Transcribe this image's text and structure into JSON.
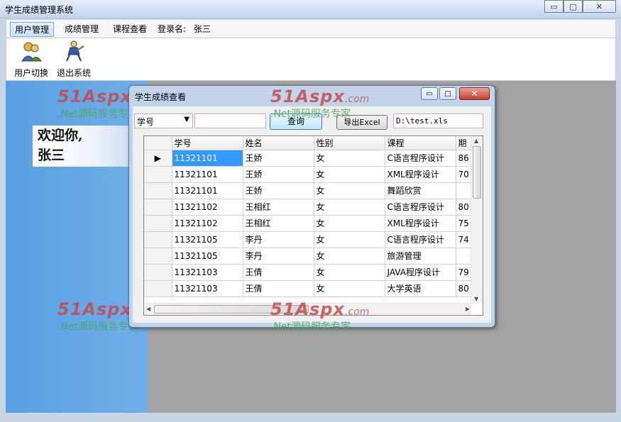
{
  "window": {
    "title": "学生成绩管理系统",
    "controls": {
      "minimize": "▭",
      "maximize": "□",
      "close": "✕"
    }
  },
  "menu": {
    "user_mgmt": "用户管理",
    "score_mgmt": "成绩管理",
    "course_view": "课程查看",
    "login_label": "登录名:",
    "login_name": "张三"
  },
  "toolbar": {
    "switch_user": "用户切换",
    "exit_system": "退出系统"
  },
  "welcome": {
    "line1": "欢迎你,",
    "line2": "张三"
  },
  "watermark": {
    "brand": "51Aspx",
    "domain": ".com",
    "tagline": ".Net源码服务专家"
  },
  "dialog": {
    "title": "学生成绩查看",
    "field_select": "学号",
    "search_value": "",
    "query_label": "查询",
    "export_label": "导出Excel",
    "path": "D:\\test.xls",
    "columns": [
      "学号",
      "姓名",
      "性别",
      "课程",
      "期"
    ],
    "rows": [
      [
        "11321101",
        "王娇",
        "女",
        "C语言程序设计",
        "86"
      ],
      [
        "11321101",
        "王娇",
        "女",
        "XML程序设计",
        "70"
      ],
      [
        "11321101",
        "王娇",
        "女",
        "舞蹈欣赏",
        ""
      ],
      [
        "11321102",
        "王相红",
        "女",
        "C语言程序设计",
        "80"
      ],
      [
        "11321102",
        "王相红",
        "女",
        "XML程序设计",
        "75"
      ],
      [
        "11321105",
        "李丹",
        "女",
        "C语言程序设计",
        "74"
      ],
      [
        "11321105",
        "李丹",
        "女",
        "旅游管理",
        ""
      ],
      [
        "11321103",
        "王倩",
        "女",
        "JAVA程序设计",
        "79"
      ],
      [
        "11321103",
        "王倩",
        "女",
        "大学英语",
        "80"
      ]
    ]
  },
  "colors": {
    "accent": "#3399ff",
    "workspace": "#7ab7ee",
    "mdi": "#a3a3a3",
    "close": "#c6402b"
  }
}
